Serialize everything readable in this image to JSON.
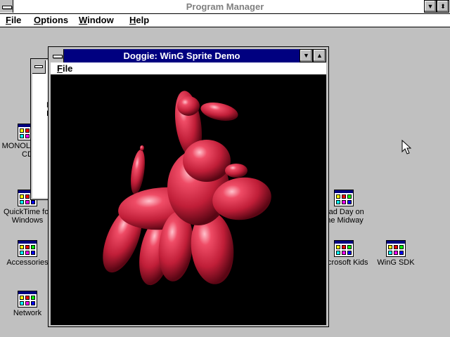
{
  "program_manager": {
    "title": "Program Manager",
    "menu": [
      {
        "pre": "",
        "u": "F",
        "post": "ile"
      },
      {
        "pre": "",
        "u": "O",
        "post": "ptions"
      },
      {
        "pre": "",
        "u": "W",
        "post": "indow"
      },
      {
        "pre": "",
        "u": "H",
        "post": "elp"
      }
    ],
    "minimize_glyph": "▼",
    "restore_glyph": "⬍"
  },
  "background_window": {
    "fragment_line1": "M",
    "fragment_line2": "I"
  },
  "doggie_window": {
    "title": "Doggie: WinG Sprite Demo",
    "menu_file": {
      "u": "F",
      "post": "ile"
    },
    "minimize_glyph": "▼",
    "maximize_glyph": "▲"
  },
  "desktop_icons": [
    {
      "line1": "MONOLOGUE",
      "line2": "CD"
    },
    {
      "line1": "QuickTime for",
      "line2": "Windows"
    },
    {
      "line1": "Accessories",
      "line2": ""
    },
    {
      "line1": "Network",
      "line2": ""
    },
    {
      "line1": "Bad Day on",
      "line2": "the Midway"
    },
    {
      "line1": "Microsoft Kids",
      "line2": ""
    },
    {
      "line1": "WinG SDK",
      "line2": ""
    }
  ],
  "colors": {
    "desktop": "#c0c0c0",
    "active_title": "#000080",
    "balloon_dog": "#d8324a"
  }
}
